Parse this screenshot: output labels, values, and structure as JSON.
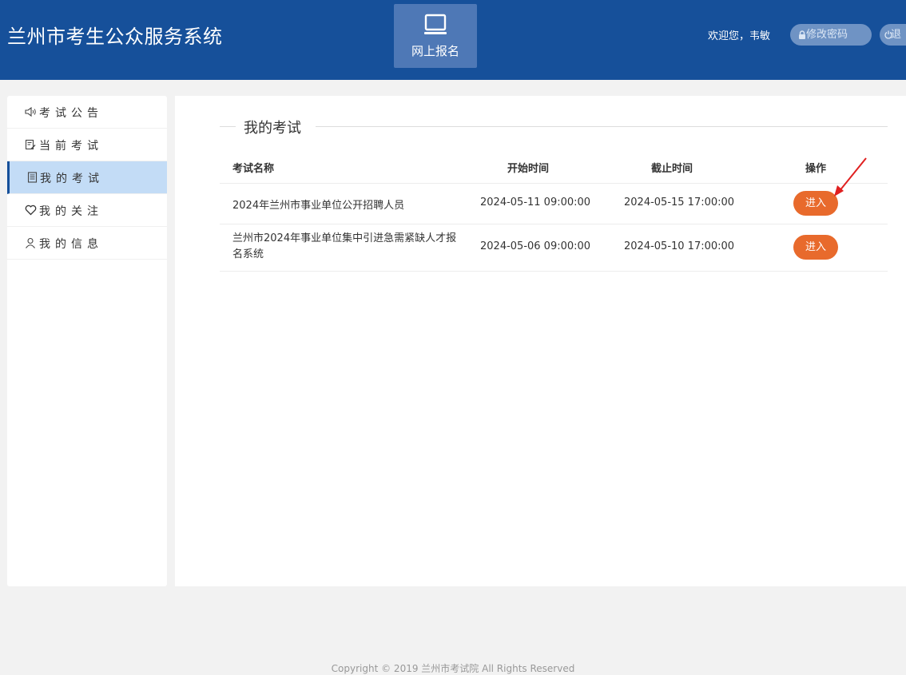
{
  "header": {
    "title": "兰州市考生公众服务系统",
    "nav_tile_label": "网上报名",
    "welcome": "欢迎您，韦敏",
    "change_password_label": "修改密码",
    "logout_label": "退"
  },
  "sidebar": {
    "items": [
      {
        "label": "考试公告",
        "icon": "megaphone-icon"
      },
      {
        "label": "当前考试",
        "icon": "document-edit-icon"
      },
      {
        "label": "我的考试",
        "icon": "document-list-icon",
        "active": true
      },
      {
        "label": "我的关注",
        "icon": "heart-icon"
      },
      {
        "label": "我的信息",
        "icon": "user-icon"
      }
    ]
  },
  "main": {
    "section_title": "我的考试",
    "table": {
      "headers": [
        "考试名称",
        "开始时间",
        "截止时间",
        "操作"
      ],
      "rows": [
        {
          "name": "2024年兰州市事业单位公开招聘人员",
          "start": "2024-05-11 09:00:00",
          "end": "2024-05-15 17:00:00",
          "action": "进入"
        },
        {
          "name": "兰州市2024年事业单位集中引进急需紧缺人才报名系统",
          "start": "2024-05-06 09:00:00",
          "end": "2024-05-10 17:00:00",
          "action": "进入"
        }
      ]
    }
  },
  "footer": {
    "text": "Copyright © 2019 兰州市考试院 All Rights Reserved"
  },
  "colors": {
    "header_bg": "#16509a",
    "accent_orange": "#e86a2c",
    "active_bg": "#c3dcf6",
    "annotation_red": "#e02020"
  }
}
